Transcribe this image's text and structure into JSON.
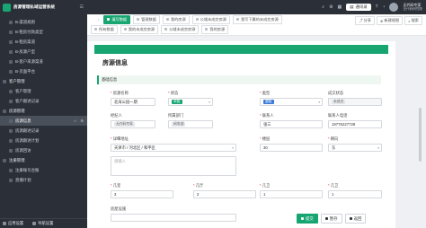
{
  "app": {
    "title": "房源管理私域运营系统"
  },
  "sidebar": {
    "items": [
      {
        "label": "B-渠道规则",
        "level": 1
      },
      {
        "label": "B-租房付款类型",
        "level": 1
      },
      {
        "label": "B-租房渠道",
        "level": 1
      },
      {
        "label": "B-房源户型",
        "level": 1
      },
      {
        "label": "B-客户来源渠道",
        "level": 1
      },
      {
        "label": "B-页面平台",
        "level": 1
      },
      {
        "label": "客户管理",
        "level": 0
      },
      {
        "label": "客户管理",
        "level": 1
      },
      {
        "label": "客户跟进记录",
        "level": 1
      },
      {
        "label": "房源管理",
        "level": 0
      },
      {
        "label": "房源信息",
        "level": 1,
        "active": true
      },
      {
        "label": "房源跟进记录",
        "level": 1
      },
      {
        "label": "房源跟进计划",
        "level": 1
      },
      {
        "label": "房源回访",
        "level": 1
      },
      {
        "label": "注册管理",
        "level": 0
      },
      {
        "label": "注册账号台账",
        "level": 1
      },
      {
        "label": "直播计划",
        "level": 1
      }
    ],
    "footer": {
      "app_settings": "应用设置",
      "nav_settings": "导航设置"
    }
  },
  "topbar": {
    "notify": "通讯录",
    "user_name": "无代码专家",
    "user_org": "无代码研究院"
  },
  "tabs": {
    "row1": [
      "填写数据",
      "管理数据",
      "我的房源",
      "公域未成交房源",
      "我写下属的未成交房源"
    ],
    "row2": [
      "所有数据",
      "我的未成交房源",
      "公域未成交房源",
      "我的房源"
    ],
    "tools": {
      "share": "分享",
      "new_view": "新建视图",
      "search": "搜索"
    }
  },
  "form": {
    "title": "房源信息",
    "section": "基础信息",
    "fields": {
      "name": {
        "label": "房源名称",
        "value": "北海公园一期"
      },
      "status": {
        "label": "状态",
        "value": "未租"
      },
      "type": {
        "label": "类型",
        "value": "整租"
      },
      "deal_status": {
        "label": "成交状态",
        "value": "未成交"
      },
      "agent": {
        "label": "经纪人",
        "value": "无代码专家"
      },
      "dept": {
        "label": "所属部门",
        "value": "研发部"
      },
      "contact": {
        "label": "联系人",
        "value": "张三"
      },
      "phone": {
        "label": "联系人电话",
        "value": "19776227728"
      },
      "address": {
        "label": "详细地址",
        "value": "天津市 / 河北区 / 和平区"
      },
      "area": {
        "label": "楼层",
        "value": "30"
      },
      "orientation": {
        "label": "朝向",
        "value": "东"
      },
      "address_detail": {
        "placeholder": "请输入"
      },
      "rooms": {
        "label": "几室",
        "value": "3"
      },
      "halls": {
        "label": "几厅",
        "value": "2"
      },
      "baths": {
        "label": "几卫",
        "value": "1"
      },
      "kitchens": {
        "label": "几卫",
        "value": "1"
      },
      "facilities": {
        "label": "房屋设施"
      }
    }
  },
  "buttons": {
    "submit": "提交",
    "save_draft": "暂存",
    "back": "返回"
  },
  "colors": {
    "accent": "#17a672",
    "sidebar": "#2b3038"
  }
}
